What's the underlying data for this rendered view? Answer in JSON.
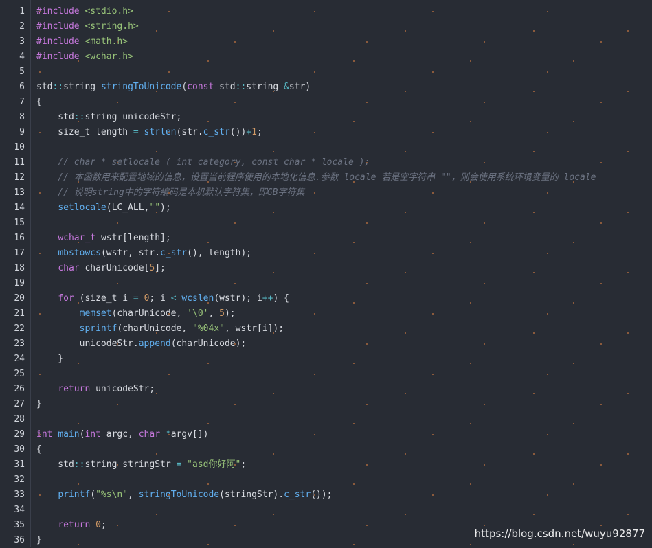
{
  "editor": {
    "lines": [
      {
        "n": "1",
        "tokens": [
          [
            "inc",
            "#include "
          ],
          [
            "str",
            "<stdio.h>"
          ]
        ]
      },
      {
        "n": "2",
        "tokens": [
          [
            "inc",
            "#include "
          ],
          [
            "str",
            "<string.h>"
          ]
        ]
      },
      {
        "n": "3",
        "tokens": [
          [
            "inc",
            "#include "
          ],
          [
            "str",
            "<math.h>"
          ]
        ]
      },
      {
        "n": "4",
        "tokens": [
          [
            "inc",
            "#include "
          ],
          [
            "str",
            "<wchar.h>"
          ]
        ]
      },
      {
        "n": "5",
        "tokens": []
      },
      {
        "n": "6",
        "tokens": [
          [
            "pl",
            "std"
          ],
          [
            "op",
            "::"
          ],
          [
            "pl",
            "string "
          ],
          [
            "fn",
            "stringToUnicode"
          ],
          [
            "pl",
            "("
          ],
          [
            "kw",
            "const "
          ],
          [
            "pl",
            "std"
          ],
          [
            "op",
            "::"
          ],
          [
            "pl",
            "string "
          ],
          [
            "op",
            "&"
          ],
          [
            "pl",
            "str)"
          ]
        ]
      },
      {
        "n": "7",
        "tokens": [
          [
            "pl",
            "{"
          ]
        ]
      },
      {
        "n": "8",
        "tokens": [
          [
            "pl",
            "    std"
          ],
          [
            "op",
            "::"
          ],
          [
            "pl",
            "string unicodeStr;"
          ]
        ]
      },
      {
        "n": "9",
        "tokens": [
          [
            "pl",
            "    size_t length "
          ],
          [
            "op",
            "= "
          ],
          [
            "fn",
            "strlen"
          ],
          [
            "pl",
            "(str."
          ],
          [
            "fn",
            "c_str"
          ],
          [
            "pl",
            "())"
          ],
          [
            "op",
            "+"
          ],
          [
            "num",
            "1"
          ],
          [
            "pl",
            ";"
          ]
        ]
      },
      {
        "n": "10",
        "tokens": []
      },
      {
        "n": "11",
        "tokens": [
          [
            "cm",
            "    // char * setlocale ( int category, const char * locale );"
          ]
        ]
      },
      {
        "n": "12",
        "tokens": [
          [
            "cm",
            "    // 本函数用来配置地域的信息，设置当前程序使用的本地化信息.参数 locale 若是空字符串 \"\"，则会使用系统环境变量的 locale"
          ]
        ]
      },
      {
        "n": "13",
        "tokens": [
          [
            "cm",
            "    // 说明string中的字符编码是本机默认字符集，即GB字符集"
          ]
        ]
      },
      {
        "n": "14",
        "tokens": [
          [
            "pl",
            "    "
          ],
          [
            "fn",
            "setlocale"
          ],
          [
            "pl",
            "(LC_ALL,"
          ],
          [
            "str",
            "\"\""
          ],
          [
            "pl",
            ");"
          ]
        ]
      },
      {
        "n": "15",
        "tokens": []
      },
      {
        "n": "16",
        "tokens": [
          [
            "pl",
            "    "
          ],
          [
            "kw",
            "wchar_t "
          ],
          [
            "pl",
            "wstr[length];"
          ]
        ]
      },
      {
        "n": "17",
        "tokens": [
          [
            "pl",
            "    "
          ],
          [
            "fn",
            "mbstowcs"
          ],
          [
            "pl",
            "(wstr, str."
          ],
          [
            "fn",
            "c_str"
          ],
          [
            "pl",
            "(), length);"
          ]
        ]
      },
      {
        "n": "18",
        "tokens": [
          [
            "pl",
            "    "
          ],
          [
            "kw",
            "char "
          ],
          [
            "pl",
            "charUnicode["
          ],
          [
            "num",
            "5"
          ],
          [
            "pl",
            "];"
          ]
        ]
      },
      {
        "n": "19",
        "tokens": []
      },
      {
        "n": "20",
        "tokens": [
          [
            "pl",
            "    "
          ],
          [
            "kw",
            "for "
          ],
          [
            "pl",
            "(size_t i "
          ],
          [
            "op",
            "= "
          ],
          [
            "num",
            "0"
          ],
          [
            "pl",
            "; i "
          ],
          [
            "op",
            "< "
          ],
          [
            "fn",
            "wcslen"
          ],
          [
            "pl",
            "(wstr); i"
          ],
          [
            "op",
            "++"
          ],
          [
            "pl",
            ") {"
          ]
        ]
      },
      {
        "n": "21",
        "tokens": [
          [
            "pl",
            "        "
          ],
          [
            "fn",
            "memset"
          ],
          [
            "pl",
            "(charUnicode, "
          ],
          [
            "str",
            "'\\0'"
          ],
          [
            "pl",
            ", "
          ],
          [
            "num",
            "5"
          ],
          [
            "pl",
            ");"
          ]
        ]
      },
      {
        "n": "22",
        "tokens": [
          [
            "pl",
            "        "
          ],
          [
            "fn",
            "sprintf"
          ],
          [
            "pl",
            "(charUnicode, "
          ],
          [
            "str",
            "\"%04x\""
          ],
          [
            "pl",
            ", wstr[i]);"
          ]
        ]
      },
      {
        "n": "23",
        "tokens": [
          [
            "pl",
            "        unicodeStr."
          ],
          [
            "fn",
            "append"
          ],
          [
            "pl",
            "(charUnicode);"
          ]
        ]
      },
      {
        "n": "24",
        "tokens": [
          [
            "pl",
            "    }"
          ]
        ]
      },
      {
        "n": "25",
        "tokens": []
      },
      {
        "n": "26",
        "tokens": [
          [
            "pl",
            "    "
          ],
          [
            "kw",
            "return "
          ],
          [
            "pl",
            "unicodeStr;"
          ]
        ]
      },
      {
        "n": "27",
        "tokens": [
          [
            "pl",
            "}"
          ]
        ]
      },
      {
        "n": "28",
        "tokens": []
      },
      {
        "n": "29",
        "tokens": [
          [
            "kw",
            "int "
          ],
          [
            "fn",
            "main"
          ],
          [
            "pl",
            "("
          ],
          [
            "kw",
            "int "
          ],
          [
            "pl",
            "argc, "
          ],
          [
            "kw",
            "char "
          ],
          [
            "op",
            "*"
          ],
          [
            "pl",
            "argv[])"
          ]
        ]
      },
      {
        "n": "30",
        "tokens": [
          [
            "pl",
            "{"
          ]
        ]
      },
      {
        "n": "31",
        "tokens": [
          [
            "pl",
            "    std"
          ],
          [
            "op",
            "::"
          ],
          [
            "pl",
            "string stringStr "
          ],
          [
            "op",
            "= "
          ],
          [
            "str",
            "\"asd你好阿\""
          ],
          [
            "pl",
            ";"
          ]
        ]
      },
      {
        "n": "32",
        "tokens": []
      },
      {
        "n": "33",
        "tokens": [
          [
            "pl",
            "    "
          ],
          [
            "fn",
            "printf"
          ],
          [
            "pl",
            "("
          ],
          [
            "str",
            "\"%s\\n\""
          ],
          [
            "pl",
            ", "
          ],
          [
            "fn",
            "stringToUnicode"
          ],
          [
            "pl",
            "(stringStr)."
          ],
          [
            "fn",
            "c_str"
          ],
          [
            "pl",
            "());"
          ]
        ]
      },
      {
        "n": "34",
        "tokens": []
      },
      {
        "n": "35",
        "tokens": [
          [
            "pl",
            "    "
          ],
          [
            "kw",
            "return "
          ],
          [
            "num",
            "0"
          ],
          [
            "pl",
            ";"
          ]
        ]
      },
      {
        "n": "36",
        "tokens": [
          [
            "pl",
            "}"
          ]
        ]
      }
    ]
  },
  "watermark": "https://blog.csdn.net/wuyu92877",
  "colors": {
    "background": "#282c34",
    "keyword": "#c678dd",
    "string": "#98c379",
    "function": "#61afef",
    "number": "#d19a66",
    "comment": "#6c7382"
  }
}
